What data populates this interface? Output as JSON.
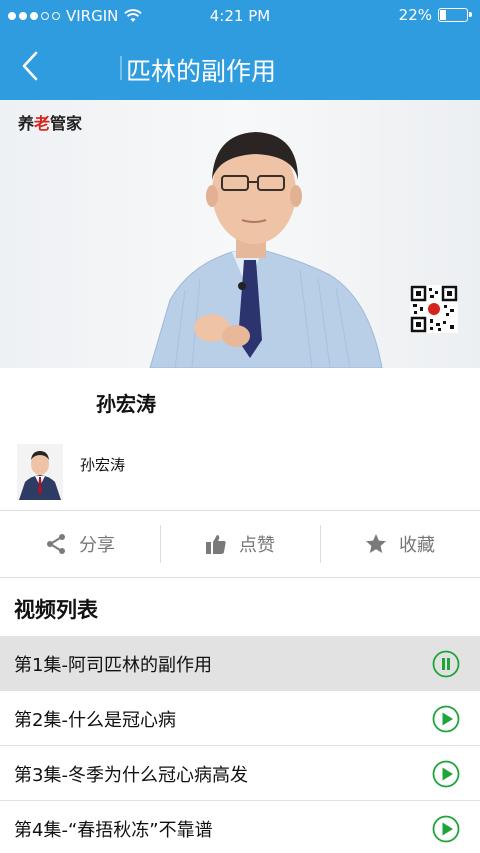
{
  "status_bar": {
    "carrier": "VIRGIN",
    "time": "4:21 PM",
    "battery_text": "22%",
    "battery_level": 0.22,
    "signal_bars": 3
  },
  "nav": {
    "title": "匹林的副作用",
    "back_icon": "chevron-left-icon"
  },
  "video": {
    "logo_text_1": "养",
    "logo_text_2": "老",
    "logo_text_3": "管家",
    "accent_red": "#d6231c"
  },
  "speaker_title": "孙宏涛",
  "author": {
    "name": "孙宏涛"
  },
  "actions": {
    "share_label": "分享",
    "like_label": "点赞",
    "favorite_label": "收藏",
    "share_icon": "share-icon",
    "like_icon": "thumbs-up-icon",
    "favorite_icon": "star-icon"
  },
  "playlist": {
    "title": "视频列表",
    "items": [
      {
        "title": "第1集-阿司匹林的副作用",
        "state": "playing",
        "icon": "pause-icon"
      },
      {
        "title": "第2集-什么是冠心病",
        "state": "idle",
        "icon": "play-icon"
      },
      {
        "title": "第3集-冬季为什么冠心病高发",
        "state": "idle",
        "icon": "play-icon"
      },
      {
        "title": "第4集-“春捂秋冻”不靠谱",
        "state": "idle",
        "icon": "play-icon"
      }
    ]
  },
  "colors": {
    "primary": "#2f9ce0",
    "play_green": "#1fa43a",
    "active_row": "#e2e2e2"
  }
}
